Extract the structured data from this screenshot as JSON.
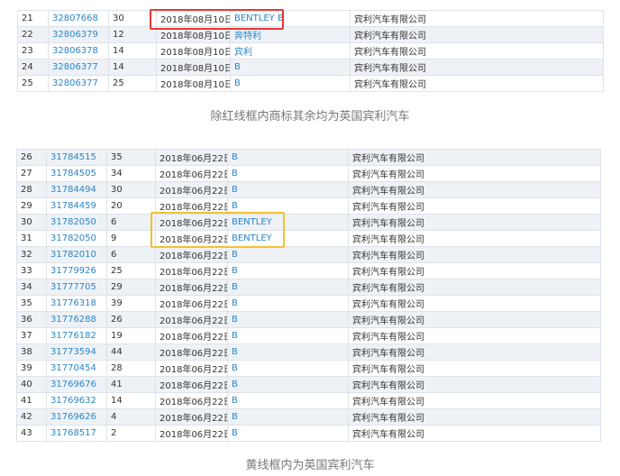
{
  "table1": {
    "rows": [
      [
        "21",
        "32807668",
        "30",
        "2018年08月10日",
        "BENTLEY B",
        "宾利汽车有限公司"
      ],
      [
        "22",
        "32806379",
        "12",
        "2018年08月10日",
        "奔特利",
        "宾利汽车有限公司"
      ],
      [
        "23",
        "32806378",
        "14",
        "2018年08月10日",
        "宾利",
        "宾利汽车有限公司"
      ],
      [
        "24",
        "32806377",
        "14",
        "2018年08月10日",
        "B",
        "宾利汽车有限公司"
      ],
      [
        "25",
        "32806377",
        "25",
        "2018年08月10日",
        "B",
        "宾利汽车有限公司"
      ]
    ]
  },
  "caption1": "除红线框内商标其余均为英国宾利汽车",
  "table2": {
    "rows": [
      [
        "26",
        "31784515",
        "35",
        "2018年06月22日",
        "B",
        "宾利汽车有限公司"
      ],
      [
        "27",
        "31784505",
        "34",
        "2018年06月22日",
        "B",
        "宾利汽车有限公司"
      ],
      [
        "28",
        "31784494",
        "30",
        "2018年06月22日",
        "B",
        "宾利汽车有限公司"
      ],
      [
        "29",
        "31784459",
        "20",
        "2018年06月22日",
        "B",
        "宾利汽车有限公司"
      ],
      [
        "30",
        "31782050",
        "6",
        "2018年06月22日",
        "BENTLEY",
        "宾利汽车有限公司"
      ],
      [
        "31",
        "31782050",
        "9",
        "2018年06月22日",
        "BENTLEY",
        "宾利汽车有限公司"
      ],
      [
        "32",
        "31782010",
        "6",
        "2018年06月22日",
        "B",
        "宾利汽车有限公司"
      ],
      [
        "33",
        "31779926",
        "25",
        "2018年06月22日",
        "B",
        "宾利汽车有限公司"
      ],
      [
        "34",
        "31777705",
        "29",
        "2018年06月22日",
        "B",
        "宾利汽车有限公司"
      ],
      [
        "35",
        "31776318",
        "39",
        "2018年06月22日",
        "B",
        "宾利汽车有限公司"
      ],
      [
        "36",
        "31776288",
        "26",
        "2018年06月22日",
        "B",
        "宾利汽车有限公司"
      ],
      [
        "37",
        "31776182",
        "19",
        "2018年06月22日",
        "B",
        "宾利汽车有限公司"
      ],
      [
        "38",
        "31773594",
        "44",
        "2018年06月22日",
        "B",
        "宾利汽车有限公司"
      ],
      [
        "39",
        "31770454",
        "28",
        "2018年06月22日",
        "B",
        "宾利汽车有限公司"
      ],
      [
        "40",
        "31769676",
        "41",
        "2018年06月22日",
        "B",
        "宾利汽车有限公司"
      ],
      [
        "41",
        "31769632",
        "14",
        "2018年06月22日",
        "B",
        "宾利汽车有限公司"
      ],
      [
        "42",
        "31769626",
        "4",
        "2018年06月22日",
        "B",
        "宾利汽车有限公司"
      ],
      [
        "43",
        "31768517",
        "2",
        "2018年06月22日",
        "B",
        "宾利汽车有限公司"
      ]
    ]
  },
  "caption2": "黄线框内为英国宾利汽车",
  "colors": {
    "red_box": "#e53935",
    "yellow_box": "#f2c230",
    "link": "#2a86c8"
  }
}
